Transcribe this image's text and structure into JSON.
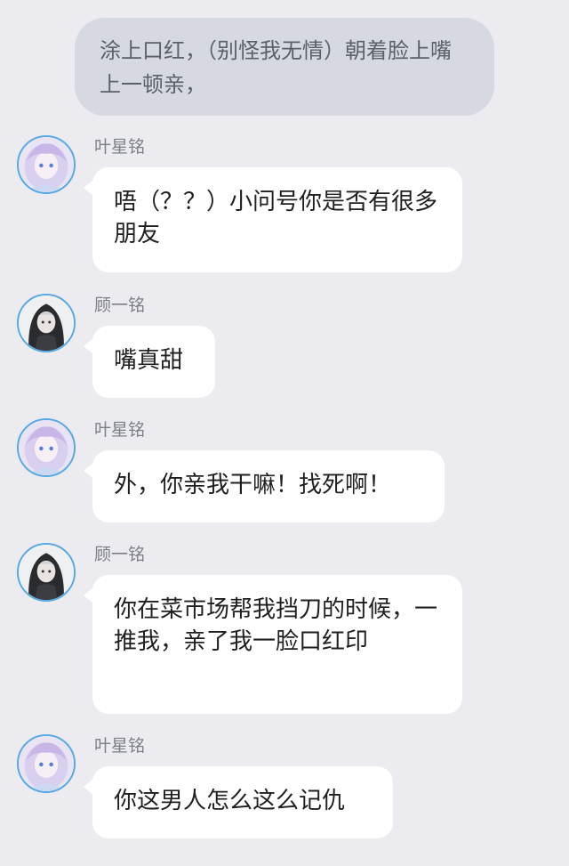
{
  "narration": "涂上口红，（别怪我无情）朝着脸上嘴上一顿亲，",
  "messages": [
    {
      "sender": "叶星铭",
      "text": "唔（？？）小问号你是否有很多朋友"
    },
    {
      "sender": "顾一铭",
      "text": "嘴真甜"
    },
    {
      "sender": "叶星铭",
      "text": "外，你亲我干嘛！找死啊！"
    },
    {
      "sender": "顾一铭",
      "text": "你在菜市场帮我挡刀的时候，一推我，亲了我一脸口红印"
    },
    {
      "sender": "叶星铭",
      "text": "你这男人怎么这么记仇"
    }
  ]
}
